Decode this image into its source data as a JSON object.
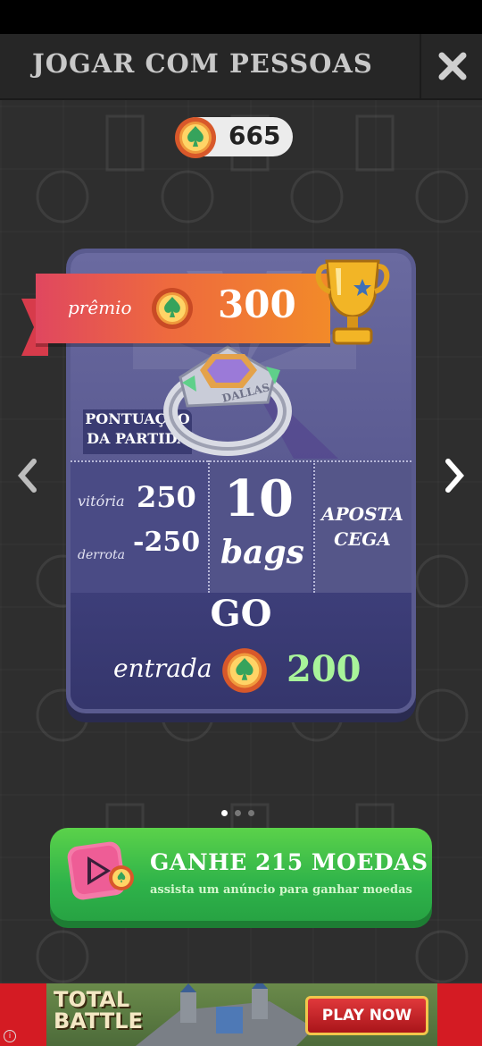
{
  "header": {
    "title": "JOGAR COM PESSOAS"
  },
  "wallet": {
    "coins": "665"
  },
  "card": {
    "prize_label": "prêmio",
    "prize_value": "300",
    "score_badge": [
      "PONTUAÇÃO",
      "DA PARTIDA"
    ],
    "ring_text": "DALLAS",
    "win_label": "vitória",
    "win_value": "250",
    "loss_label": "derrota",
    "loss_value": "-250",
    "bags_number": "10",
    "bags_word": "bags",
    "blind_line1": "APOSTA",
    "blind_line2": "CEGA",
    "go_label": "GO",
    "entry_label": "entrada",
    "entry_value": "200"
  },
  "pager": {
    "count": 3,
    "active": 0
  },
  "ad_button": {
    "title": "GANHE 215 MOEDAS",
    "subtitle": "assista um anúncio para ganhar moedas"
  },
  "banner": {
    "logo_line1": "TOTAL",
    "logo_line2": "BATTLE",
    "cta": "PLAY NOW"
  },
  "colors": {
    "card": "#41427a",
    "prize_ribbon": "#ee6a3e",
    "entry_value": "#a8f39a",
    "ad_button": "#2fb34a",
    "banner": "#d41b23"
  }
}
